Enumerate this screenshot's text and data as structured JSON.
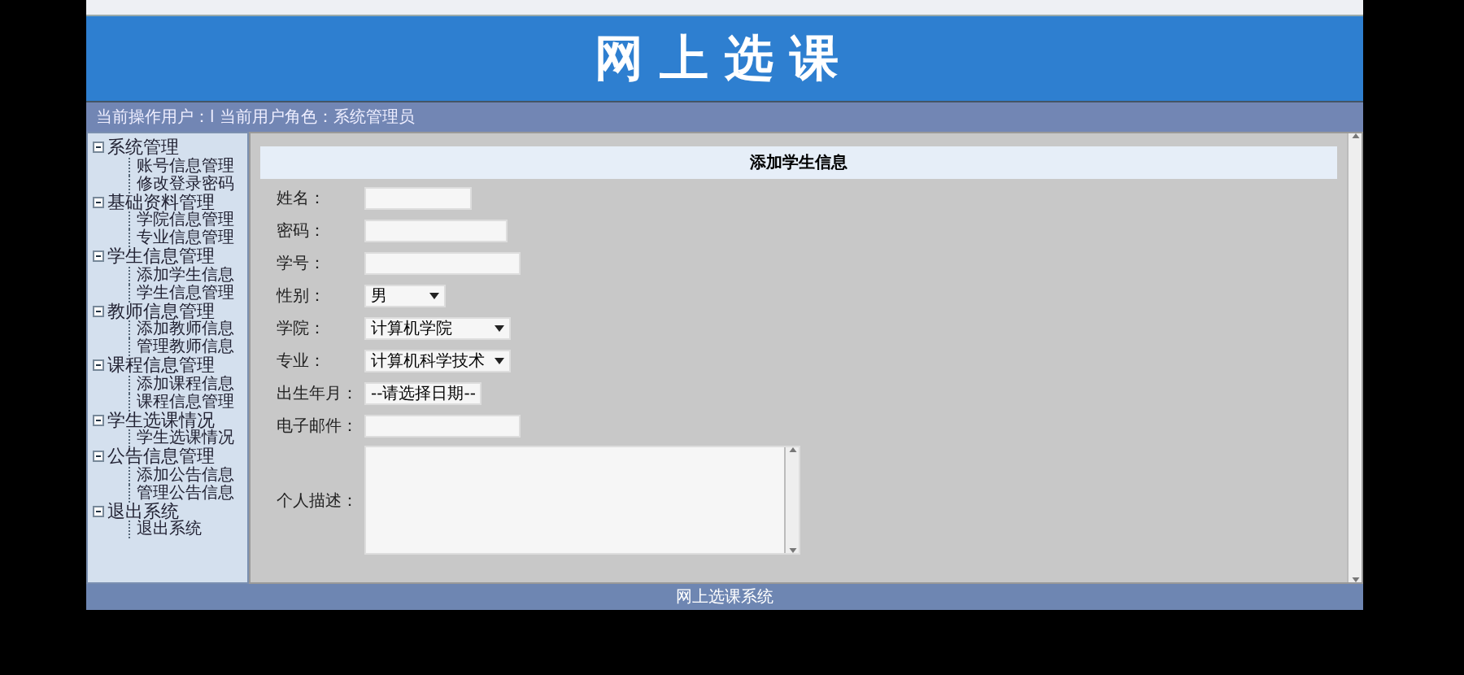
{
  "header": {
    "title": "网上选课"
  },
  "user_bar": {
    "text": "当前操作用户：l 当前用户角色：系统管理员"
  },
  "sidebar": {
    "items": [
      {
        "label": "系统管理",
        "expanded": true,
        "children": [
          {
            "label": "账号信息管理"
          },
          {
            "label": "修改登录密码"
          }
        ]
      },
      {
        "label": "基础资料管理",
        "expanded": true,
        "children": [
          {
            "label": "学院信息管理"
          },
          {
            "label": "专业信息管理"
          }
        ]
      },
      {
        "label": "学生信息管理",
        "expanded": true,
        "children": [
          {
            "label": "添加学生信息"
          },
          {
            "label": "学生信息管理"
          }
        ]
      },
      {
        "label": "教师信息管理",
        "expanded": true,
        "children": [
          {
            "label": "添加教师信息"
          },
          {
            "label": "管理教师信息"
          }
        ]
      },
      {
        "label": "课程信息管理",
        "expanded": true,
        "children": [
          {
            "label": "添加课程信息"
          },
          {
            "label": "课程信息管理"
          }
        ]
      },
      {
        "label": "学生选课情况",
        "expanded": true,
        "children": [
          {
            "label": "学生选课情况"
          }
        ]
      },
      {
        "label": "公告信息管理",
        "expanded": true,
        "children": [
          {
            "label": "添加公告信息"
          },
          {
            "label": "管理公告信息"
          }
        ]
      },
      {
        "label": "退出系统",
        "expanded": true,
        "children": [
          {
            "label": "退出系统"
          }
        ]
      }
    ]
  },
  "form": {
    "title": "添加学生信息",
    "fields": [
      {
        "label": "姓名：",
        "kind": "text"
      },
      {
        "label": "密码：",
        "kind": "text"
      },
      {
        "label": "学号：",
        "kind": "text"
      },
      {
        "label": "性别：",
        "kind": "select",
        "value": "男"
      },
      {
        "label": "学院：",
        "kind": "select",
        "value": "计算机学院"
      },
      {
        "label": "专业：",
        "kind": "select",
        "value": "计算机科学技术"
      },
      {
        "label": "出生年月：",
        "kind": "text",
        "value": "--请选择日期--"
      },
      {
        "label": "电子邮件：",
        "kind": "text"
      },
      {
        "label": "个人描述：",
        "kind": "textarea"
      }
    ]
  },
  "footer": {
    "text": "网上选课系统"
  }
}
